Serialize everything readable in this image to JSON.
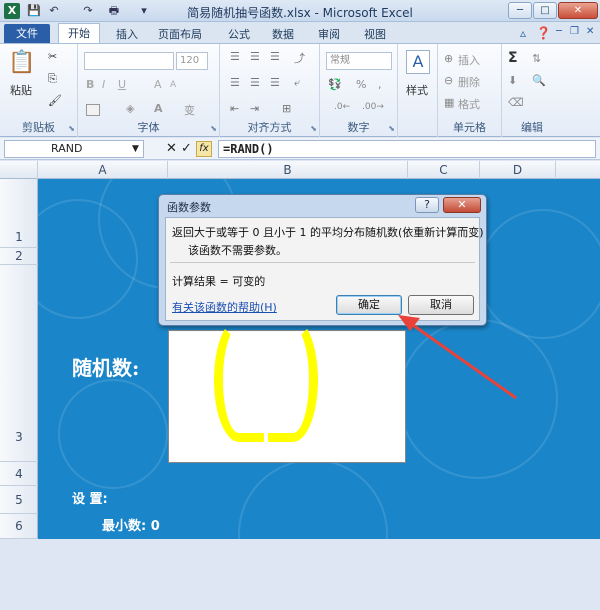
{
  "window": {
    "title": "简易随机抽号函数.xlsx - Microsoft Excel",
    "logo": "X"
  },
  "qat": {
    "save_icon": "💾",
    "undo_icon": "↶",
    "redo_icon": "↷",
    "print_icon": "🖶",
    "more_icon": "▾"
  },
  "winctrl": {
    "min": "─",
    "max": "□",
    "close": "✕",
    "rmin": "─",
    "rmax": "❐",
    "rclose": "✕"
  },
  "tabs": {
    "file": "文件",
    "home": "开始",
    "insert": "插入",
    "layout": "页面布局",
    "formulas": "公式",
    "data": "数据",
    "review": "审阅",
    "view": "视图"
  },
  "ribbon": {
    "clipboard": {
      "label": "剪贴板",
      "paste": "粘贴"
    },
    "font": {
      "label": "字体",
      "size": "120",
      "grow": "A",
      "shrink": "A"
    },
    "alignment": {
      "label": "对齐方式"
    },
    "number": {
      "label": "数字",
      "format": "常规",
      "percent": "%",
      "comma": ","
    },
    "styles": {
      "label": "样式",
      "letter": "A"
    },
    "cells": {
      "label": "单元格",
      "insert": "插入",
      "delete": "删除",
      "format": "格式"
    },
    "editing": {
      "label": "编辑",
      "sum": "Σ"
    }
  },
  "formula_bar": {
    "name_box": "RAND",
    "formula": "=RAND()",
    "cancel": "✕",
    "confirm": "✓",
    "fx": "fx"
  },
  "columns": [
    "A",
    "B",
    "C",
    "D"
  ],
  "rows": [
    "1",
    "2",
    "3",
    "4",
    "5",
    "6"
  ],
  "sheet": {
    "random_label": "随机数:",
    "settings_label": "设 置:",
    "min_label": "最小数: 0",
    "paren_open": "(",
    "paren_close": ")"
  },
  "dialog": {
    "title": "函数参数",
    "help_btn": "?",
    "close_btn": "✕",
    "description": "返回大于或等于 0 且小于 1 的平均分布随机数(依重新计算而变)",
    "no_args": "该函数不需要参数。",
    "result": "计算结果 = 可变的",
    "help_link": "有关该函数的帮助(H)",
    "ok": "确定",
    "cancel": "取消"
  },
  "colors": {
    "sheet_bg": "#1a86c9",
    "file_tab": "#2a5fa8",
    "arrow": "#e8423a",
    "paren": "#ffff00"
  }
}
